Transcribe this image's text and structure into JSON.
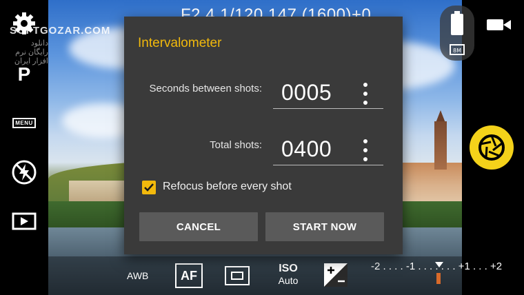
{
  "watermark": {
    "text": "SOFTGOZAR.COM",
    "subtext": "دانلود رایگان نرم افزار ایران"
  },
  "top_readout": "F2.4  1/120    147  (1600)+0",
  "left_rail": {
    "mode": "P",
    "menu_label": "MENU"
  },
  "bottom_bar": {
    "white_balance": "AWB",
    "focus_mode": "AF",
    "iso_label": "ISO",
    "iso_value": "Auto",
    "ev_scale": "-2 . . . . -1 . . . . . . . +1 . . . +2"
  },
  "dialog": {
    "title": "Intervalometer",
    "seconds_label": "Seconds between shots:",
    "seconds_value": "0005",
    "total_label": "Total shots:",
    "total_value": "0400",
    "refocus_label": "Refocus before every shot",
    "refocus_checked": true,
    "cancel_label": "CANCEL",
    "start_label": "START NOW"
  },
  "colors": {
    "accent": "#f2b90c",
    "shutter": "#f4d21a",
    "dialog_bg": "#3a3a3a",
    "button_bg": "#5a5a5a"
  }
}
